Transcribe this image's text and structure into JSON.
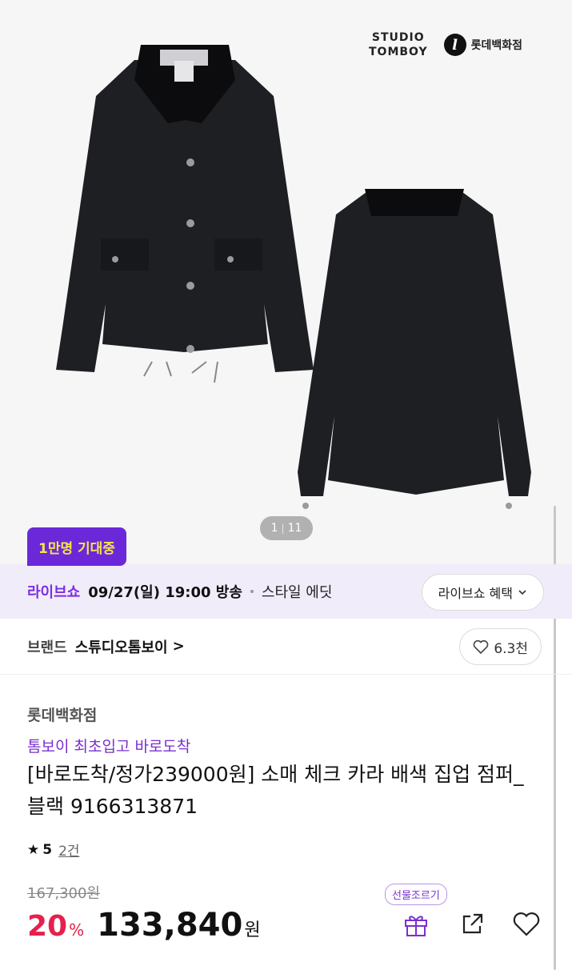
{
  "hero": {
    "studio_logo_line1": "STUDIO",
    "studio_logo_line2": "TOMBOY",
    "lotte_logo_mark": "l",
    "lotte_logo_text": "롯데백화점",
    "pager_current": "1",
    "pager_total": "11"
  },
  "badge": {
    "label": "1만명 기대중"
  },
  "live": {
    "label": "라이브쇼",
    "time": "09/27(일) 19:00 방송",
    "name": "스타일 에딧",
    "benefit_label": "라이브쇼 혜택",
    "benefit_icon": "chevron-down-icon"
  },
  "brand": {
    "label": "브랜드",
    "name": "스튜디오톰보이",
    "arrow": ">",
    "like_count": "6.3천"
  },
  "product": {
    "seller": "롯데백화점",
    "promo": "톰보이 최초입고 바로도착",
    "title": "[바로도착/정가239000원] 소매 체크 카라 배색 집업 점퍼_블랙 9166313871",
    "rating_star": "★",
    "rating_score": "5",
    "review_count": "2건",
    "original_price": "167,300원",
    "discount": "20",
    "discount_unit": "%",
    "price": "133,840",
    "price_unit": "원"
  },
  "actions": {
    "gift_bubble": "선물조르기"
  },
  "colors": {
    "accent_purple": "#7b2fe0",
    "badge_bg": "#6b28d9",
    "badge_text": "#f5e44a",
    "discount_red": "#e6204c"
  }
}
